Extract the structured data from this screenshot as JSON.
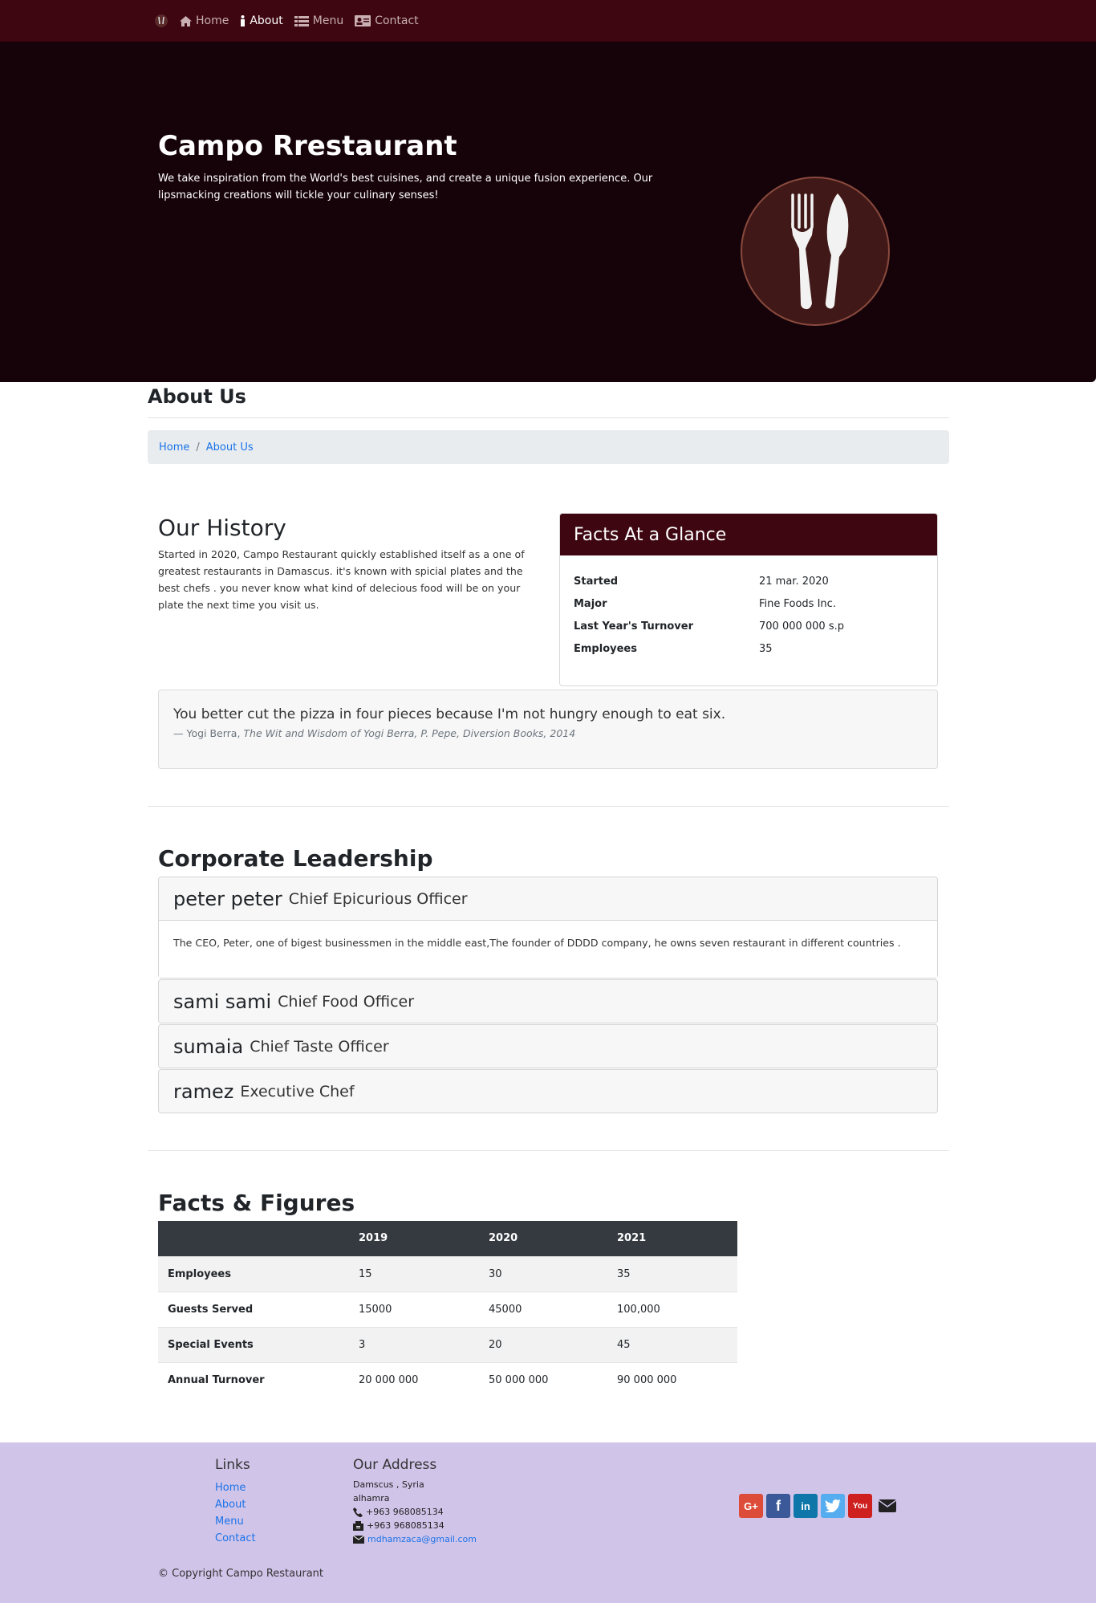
{
  "nav": {
    "items": [
      {
        "label": "Home",
        "icon": "home-icon"
      },
      {
        "label": "About",
        "icon": "info-icon"
      },
      {
        "label": "Menu",
        "icon": "list-icon"
      },
      {
        "label": "Contact",
        "icon": "address-card-icon"
      }
    ],
    "active": "About"
  },
  "jumbotron": {
    "title": "Campo Rrestaurant",
    "text": "We take inspiration from the World's best cuisines, and create a unique fusion experience. Our lipsmacking creations will tickle your culinary senses!"
  },
  "page": {
    "title": "About Us",
    "breadcrumb": [
      "Home",
      "About Us"
    ],
    "breadcrumb_sep": "/"
  },
  "history": {
    "title": "Our History",
    "text": "Started in 2020, Campo Restaurant quickly established itself as a one of greatest restaurants in Damascus. it's known with spicial plates and the best chefs . you never know what kind of delecious food will be on your plate the next time you visit us."
  },
  "facts": {
    "title": "Facts At a Glance",
    "rows": [
      {
        "k": "Started",
        "v": "21 mar. 2020"
      },
      {
        "k": "Major",
        "v": "Fine Foods Inc."
      },
      {
        "k": "Last Year's Turnover",
        "v": "700 000 000 s.p"
      },
      {
        "k": "Employees",
        "v": "35"
      }
    ]
  },
  "quote": {
    "text": "You better cut the pizza in four pieces because I'm not hungry enough to eat six.",
    "author": "— Yogi Berra,",
    "source": "The Wit and Wisdom of Yogi Berra, P. Pepe, Diversion Books, 2014"
  },
  "leadership": {
    "title": "Corporate Leadership",
    "people": [
      {
        "name": "peter peter",
        "role": "Chief Epicurious Officer",
        "bio": "The CEO, Peter, one of bigest businessmen in the middle east,The founder of DDDD company, he owns seven restaurant in different countries ."
      },
      {
        "name": "sami sami",
        "role": "Chief Food Officer"
      },
      {
        "name": "sumaia",
        "role": "Chief Taste Officer"
      },
      {
        "name": "ramez",
        "role": "Executive Chef"
      }
    ]
  },
  "figures": {
    "title": "Facts & Figures",
    "headers": [
      "",
      "2019",
      "2020",
      "2021"
    ],
    "rows": [
      [
        "Employees",
        "15",
        "30",
        "35"
      ],
      [
        "Guests Served",
        "15000",
        "45000",
        "100,000"
      ],
      [
        "Special Events",
        "3",
        "20",
        "45"
      ],
      [
        "Annual Turnover",
        "20 000 000",
        "50 000 000",
        "90 000 000"
      ]
    ]
  },
  "footer": {
    "links_title": "Links",
    "links": [
      "Home",
      "About",
      "Menu",
      "Contact"
    ],
    "address_title": "Our Address",
    "address_lines": [
      "Damscus , Syria",
      "alhamra"
    ],
    "phone": "+963 968085134",
    "fax": "+963 968085134",
    "email": "mdhamzaca@gmail.com",
    "social": [
      {
        "name": "google-plus",
        "label": "G+",
        "color": "#dd4b39"
      },
      {
        "name": "facebook",
        "label": "f",
        "color": "#3b5998"
      },
      {
        "name": "linkedin",
        "label": "in",
        "color": "#0e76a8"
      },
      {
        "name": "twitter",
        "label": "t",
        "color": "#55acee"
      },
      {
        "name": "youtube",
        "label": "You",
        "color": "#cd201f"
      }
    ],
    "copyright": "© Copyright Campo Restaurant"
  },
  "colors": {
    "navbar": "#3d0610",
    "jumbotron": "#160309",
    "footer": "#d1c4e9",
    "link": "#1a73e8"
  }
}
